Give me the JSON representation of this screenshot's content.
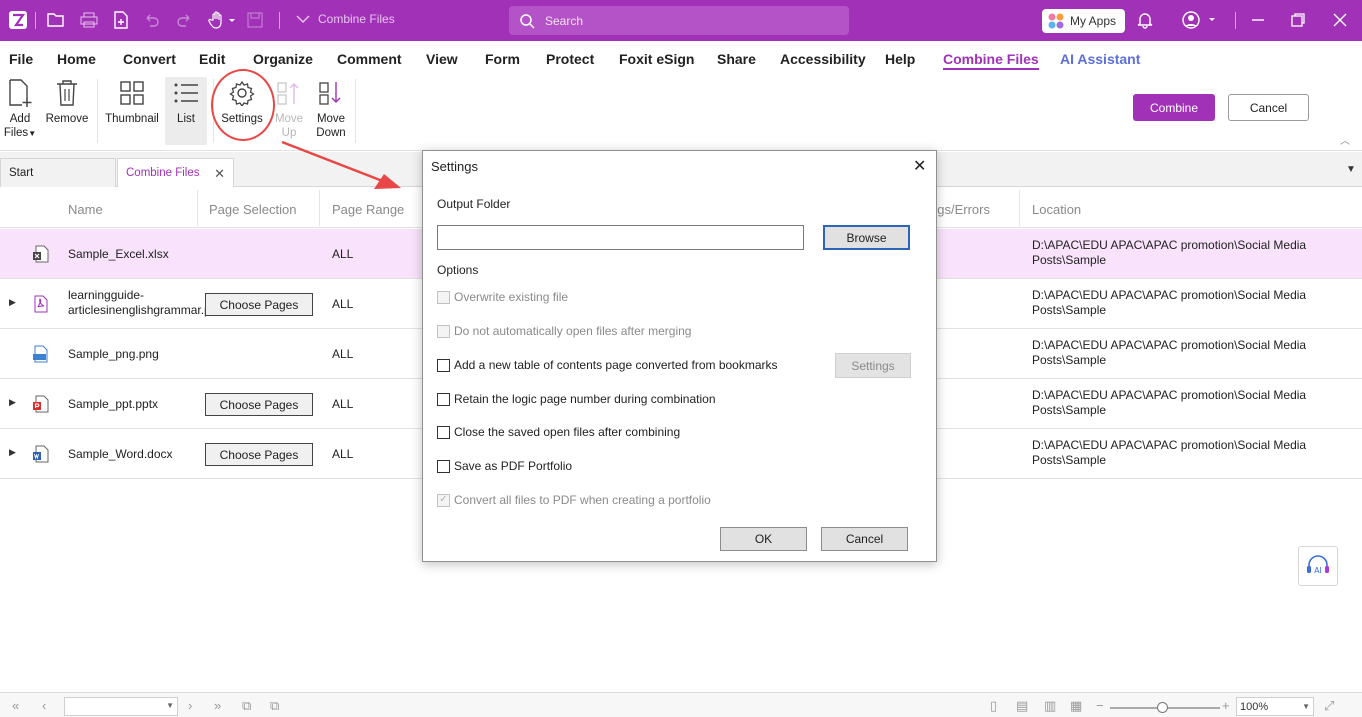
{
  "titlebar": {
    "doc_title": "Combine Files",
    "search_placeholder": "Search",
    "my_apps": "My Apps"
  },
  "menu": [
    "File",
    "Home",
    "Convert",
    "Edit",
    "Organize",
    "Comment",
    "View",
    "Form",
    "Protect",
    "Foxit eSign",
    "Share",
    "Accessibility",
    "Help",
    "Combine Files",
    "AI Assistant"
  ],
  "ribbon": {
    "add_files": [
      "Add",
      "Files"
    ],
    "remove": "Remove",
    "thumbnail": "Thumbnail",
    "list": "List",
    "settings": "Settings",
    "move_up": [
      "Move",
      "Up"
    ],
    "move_down": [
      "Move",
      "Down"
    ],
    "combine": "Combine",
    "cancel": "Cancel"
  },
  "tabs": {
    "start": "Start",
    "combine_files": "Combine Files"
  },
  "table": {
    "headers": [
      "Name",
      "Page Selection",
      "Page Range",
      "ngs/Errors",
      "Location"
    ],
    "rows": [
      {
        "name": "Sample_Excel.xlsx",
        "choose": "",
        "range": "ALL",
        "location": "D:\\APAC\\EDU APAC\\APAC promotion\\Social Media Posts\\Sample",
        "icon": "excel-file-icon"
      },
      {
        "name": "learningguide-articlesinenglishgrammar.pdf",
        "choose": "Choose Pages",
        "range": "ALL",
        "location": "D:\\APAC\\EDU APAC\\APAC promotion\\Social Media Posts\\Sample",
        "icon": "pdf-file-icon"
      },
      {
        "name": "Sample_png.png",
        "choose": "",
        "range": "ALL",
        "location": "D:\\APAC\\EDU APAC\\APAC promotion\\Social Media Posts\\Sample",
        "icon": "png-file-icon"
      },
      {
        "name": "Sample_ppt.pptx",
        "choose": "Choose Pages",
        "range": "ALL",
        "location": "D:\\APAC\\EDU APAC\\APAC promotion\\Social Media Posts\\Sample",
        "icon": "ppt-file-icon"
      },
      {
        "name": "Sample_Word.docx",
        "choose": "Choose Pages",
        "range": "ALL",
        "location": "D:\\APAC\\EDU APAC\\APAC promotion\\Social Media Posts\\Sample",
        "icon": "word-file-icon"
      }
    ]
  },
  "dialog": {
    "title": "Settings",
    "output_folder_label": "Output Folder",
    "output_folder_value": "",
    "browse": "Browse",
    "options_label": "Options",
    "options": [
      {
        "label": "Overwrite existing file",
        "checked": false,
        "disabled": true
      },
      {
        "label": "Do not automatically open files after merging",
        "checked": false,
        "disabled": true
      },
      {
        "label": "Add a new table of contents page converted from bookmarks",
        "checked": false,
        "disabled": false
      },
      {
        "label": "Retain the logic page number during combination",
        "checked": false,
        "disabled": false
      },
      {
        "label": "Close the saved open files after combining",
        "checked": false,
        "disabled": false
      },
      {
        "label": "Save as PDF Portfolio",
        "checked": false,
        "disabled": false
      },
      {
        "label": "Convert all files to PDF when creating a portfolio",
        "checked": true,
        "disabled": true
      }
    ],
    "toc_settings": "Settings",
    "ok": "OK",
    "cancel": "Cancel"
  },
  "statusbar": {
    "zoom": "100%",
    "zoom_level": 0.43
  },
  "colors": {
    "brand": "#a132b8",
    "annotation": "#e94747"
  }
}
